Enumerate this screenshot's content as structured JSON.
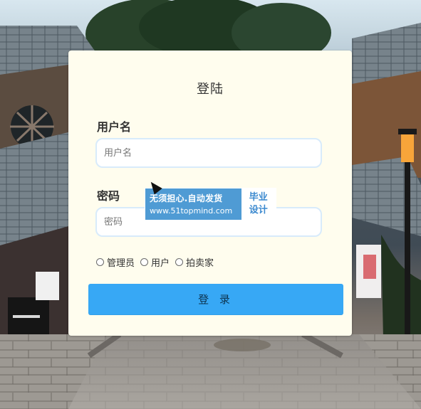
{
  "login": {
    "title": "登陆",
    "username_label": "用户名",
    "username_placeholder": "用户名",
    "password_label": "密码",
    "password_placeholder": "密码",
    "roles": [
      "管理员",
      "用户",
      "拍卖家"
    ],
    "button_label": "登 录"
  },
  "watermark": {
    "line1": "无须担心.自动发货",
    "line2": "www.51topmind.com",
    "badge_line1": "毕业",
    "badge_line2": "设计"
  },
  "colors": {
    "card": "#fffdee",
    "button": "#37a8f5",
    "input_border": "#d8ebfb",
    "watermark": "#4f9bd4"
  }
}
